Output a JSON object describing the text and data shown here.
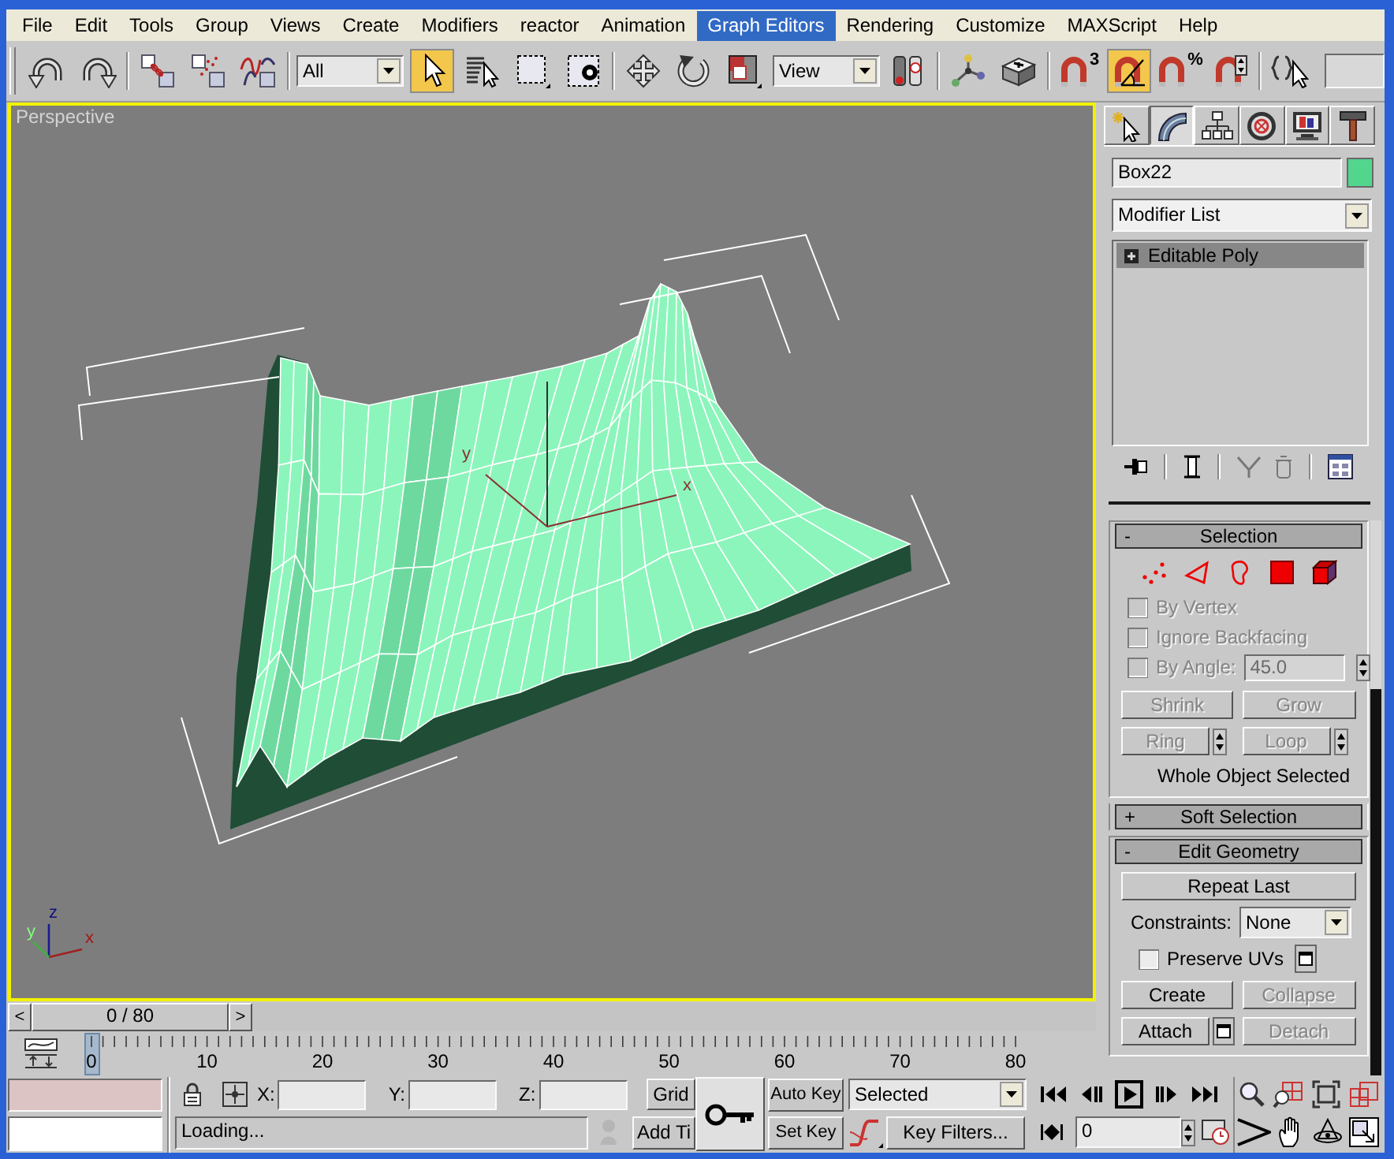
{
  "menu_bar": [
    {
      "label": "File",
      "selected": false
    },
    {
      "label": "Edit",
      "selected": false
    },
    {
      "label": "Tools",
      "selected": false
    },
    {
      "label": "Group",
      "selected": false
    },
    {
      "label": "Views",
      "selected": false
    },
    {
      "label": "Create",
      "selected": false
    },
    {
      "label": "Modifiers",
      "selected": false
    },
    {
      "label": "reactor",
      "selected": false
    },
    {
      "label": "Animation",
      "selected": false
    },
    {
      "label": "Graph Editors",
      "selected": true
    },
    {
      "label": "Rendering",
      "selected": false
    },
    {
      "label": "Customize",
      "selected": false
    },
    {
      "label": "MAXScript",
      "selected": false
    },
    {
      "label": "Help",
      "selected": false
    }
  ],
  "main_toolbar": [
    {
      "kind": "button",
      "on": false
    },
    {
      "kind": "button",
      "on": false
    },
    {
      "kind": "separator"
    },
    {
      "kind": "button",
      "on": false
    },
    {
      "kind": "button",
      "on": false
    },
    {
      "kind": "button",
      "on": false
    },
    {
      "kind": "separator"
    },
    {
      "kind": "dropdown",
      "value": "All"
    },
    {
      "kind": "button",
      "on": true
    },
    {
      "kind": "button",
      "on": false
    },
    {
      "kind": "button",
      "on": false
    },
    {
      "kind": "button",
      "on": false
    },
    {
      "kind": "separator"
    },
    {
      "kind": "button",
      "on": false
    },
    {
      "kind": "button",
      "on": false
    },
    {
      "kind": "button",
      "on": false
    },
    {
      "kind": "dropdown",
      "value": "View"
    },
    {
      "kind": "button",
      "on": false
    },
    {
      "kind": "separator"
    },
    {
      "kind": "button",
      "on": false
    },
    {
      "kind": "button",
      "on": false
    },
    {
      "kind": "separator"
    },
    {
      "kind": "button",
      "on": false,
      "badge": "3"
    },
    {
      "kind": "button",
      "on": true
    },
    {
      "kind": "button",
      "on": false,
      "badge": "%"
    },
    {
      "kind": "button",
      "on": false
    },
    {
      "kind": "separator"
    },
    {
      "kind": "button",
      "on": false
    },
    {
      "kind": "field"
    }
  ],
  "viewport": {
    "label": "Perspective",
    "active": true,
    "gizmo": {
      "y": "y",
      "x": "x"
    },
    "tripod": {
      "z": "z",
      "y": "y",
      "x": "x"
    }
  },
  "command_panel": {
    "tabs": [
      {
        "selected": false
      },
      {
        "selected": true
      },
      {
        "selected": false
      },
      {
        "selected": false
      },
      {
        "selected": false
      },
      {
        "selected": false
      }
    ],
    "object_name": "Box22",
    "modifier_list": "Modifier List",
    "stack": [
      {
        "label": "Editable Poly",
        "selected": true,
        "expanded": false
      }
    ],
    "stack_tools": [
      {
        "kind": "button",
        "disabled": false
      },
      {
        "kind": "separator"
      },
      {
        "kind": "button",
        "disabled": false
      },
      {
        "kind": "separator"
      },
      {
        "kind": "button",
        "disabled": true
      },
      {
        "kind": "button",
        "disabled": true
      },
      {
        "kind": "separator"
      },
      {
        "kind": "button",
        "disabled": false
      }
    ],
    "rollouts": [
      {
        "kind": "selection",
        "sign": "-",
        "title": "Selection",
        "expanded": true,
        "levels": [
          {
            "selected": false
          },
          {
            "selected": false
          },
          {
            "selected": false
          },
          {
            "selected": false
          },
          {
            "selected": false
          }
        ],
        "options": [
          {
            "label": "By Vertex",
            "checked": false,
            "disabled": true
          },
          {
            "label": "Ignore Backfacing",
            "checked": false,
            "disabled": true
          },
          {
            "label": "By Angle:",
            "checked": false,
            "disabled": true,
            "value": "45.0"
          }
        ],
        "buttons": [
          {
            "label": "Shrink",
            "disabled": true,
            "spinner": false
          },
          {
            "label": "Grow",
            "disabled": true,
            "spinner": false
          },
          {
            "label": "Ring",
            "disabled": true,
            "spinner": true
          },
          {
            "label": "Loop",
            "disabled": true,
            "spinner": true
          }
        ],
        "info": "Whole Object Selected"
      },
      {
        "kind": "soft_selection",
        "sign": "+",
        "title": "Soft Selection",
        "expanded": false
      },
      {
        "kind": "edit_geometry",
        "sign": "-",
        "title": "Edit Geometry",
        "expanded": true,
        "repeat": {
          "label": "Repeat Last",
          "disabled": false
        },
        "constraints": {
          "label": "Constraints:",
          "value": "None"
        },
        "preserve_uvs": {
          "label": "Preserve UVs",
          "checked": false
        },
        "buttons": [
          {
            "label": "Create",
            "disabled": false,
            "settings": false
          },
          {
            "label": "Collapse",
            "disabled": true,
            "settings": false
          },
          {
            "label": "Attach",
            "disabled": false,
            "settings": true
          },
          {
            "label": "Detach",
            "disabled": true,
            "settings": false
          }
        ]
      }
    ]
  },
  "time_slider": {
    "prev": "<",
    "label": "0 / 80",
    "next": ">",
    "level": 0
  },
  "track_bar": {
    "level": 0,
    "labels": [
      "0",
      "10",
      "20",
      "30",
      "40",
      "50",
      "60",
      "70",
      "80"
    ]
  },
  "status": {
    "x_label": "X:",
    "y_label": "Y:",
    "z_label": "Z:",
    "grid": "Grid",
    "prompt": "Loading...",
    "add_time_tag": "Add Ti"
  },
  "animation": {
    "auto_key": {
      "label": "Auto Key",
      "on": false
    },
    "key_mode": "Selected",
    "set_key": "Set Key",
    "key_filters": "Key Filters...",
    "frame": "0"
  }
}
